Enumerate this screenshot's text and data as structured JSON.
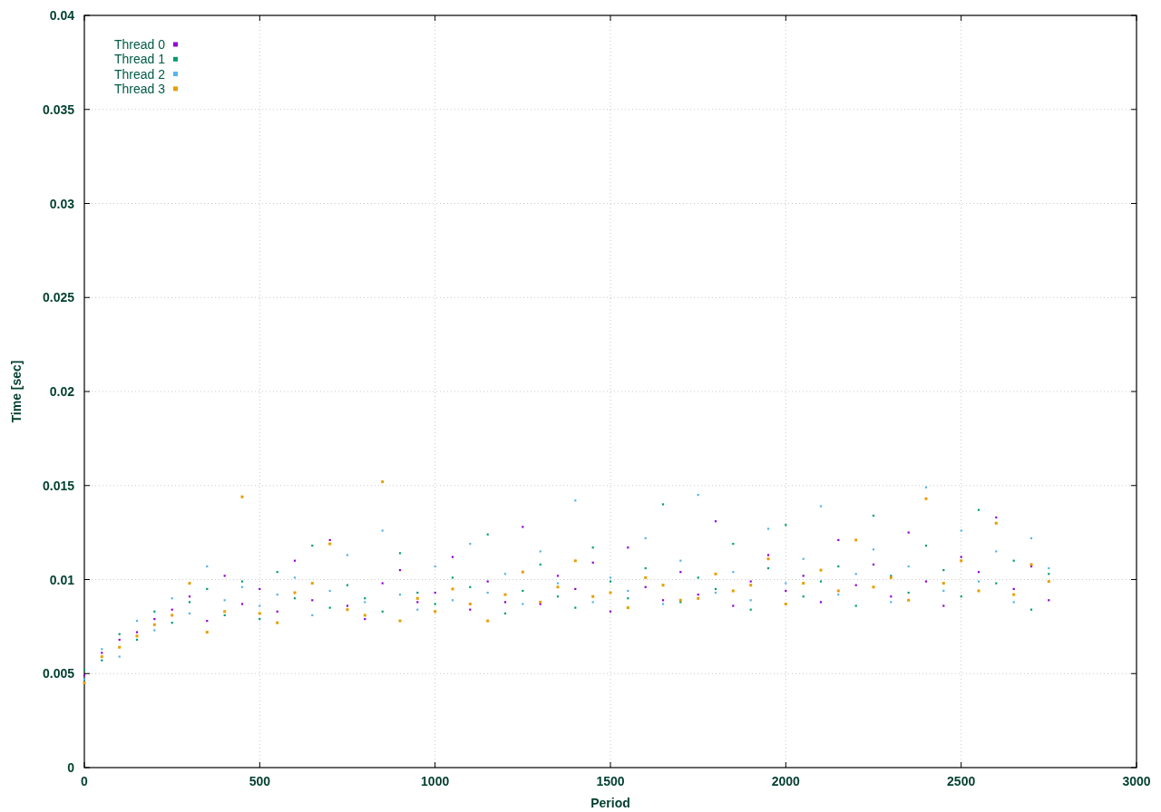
{
  "chart_data": {
    "type": "scatter",
    "grid": true,
    "legend": true,
    "xlabel": "Period",
    "ylabel": "Time [sec]",
    "xlim": [
      0,
      3000
    ],
    "ylim": [
      0,
      0.04
    ],
    "xticks": [
      0,
      500,
      1000,
      1500,
      2000,
      2500,
      3000
    ],
    "yticks": [
      {
        "value": 0,
        "label": "0"
      },
      {
        "value": 0.005,
        "label": "0.005"
      },
      {
        "value": 0.01,
        "label": "0.01"
      },
      {
        "value": 0.015,
        "label": "0.015"
      },
      {
        "value": 0.02,
        "label": "0.02"
      },
      {
        "value": 0.025,
        "label": "0.025"
      },
      {
        "value": 0.03,
        "label": "0.03"
      },
      {
        "value": 0.035,
        "label": "0.035"
      },
      {
        "value": 0.04,
        "label": "0.04"
      }
    ],
    "x": [
      0,
      50,
      100,
      150,
      200,
      250,
      300,
      350,
      400,
      450,
      500,
      550,
      600,
      650,
      700,
      750,
      800,
      850,
      900,
      950,
      1000,
      1050,
      1100,
      1150,
      1200,
      1250,
      1300,
      1350,
      1400,
      1450,
      1500,
      1550,
      1600,
      1650,
      1700,
      1750,
      1800,
      1850,
      1900,
      1950,
      2000,
      2050,
      2100,
      2150,
      2200,
      2250,
      2300,
      2350,
      2400,
      2450,
      2500,
      2550,
      2600,
      2650,
      2700,
      2750
    ],
    "series": [
      {
        "name": "Thread 0",
        "color": "#9400d3",
        "values": [
          0.0049,
          0.0061,
          0.0068,
          0.0072,
          0.0079,
          0.0084,
          0.0091,
          0.0078,
          0.0102,
          0.0087,
          0.0095,
          0.0083,
          0.011,
          0.0089,
          0.0121,
          0.0086,
          0.0079,
          0.0098,
          0.0105,
          0.0088,
          0.0093,
          0.0112,
          0.0084,
          0.0099,
          0.0088,
          0.0128,
          0.0087,
          0.0102,
          0.0095,
          0.0109,
          0.0083,
          0.0117,
          0.0096,
          0.0089,
          0.0104,
          0.0092,
          0.0131,
          0.0086,
          0.0099,
          0.0113,
          0.0094,
          0.0102,
          0.0088,
          0.0121,
          0.0097,
          0.0108,
          0.0091,
          0.0125,
          0.0099,
          0.0086,
          0.0112,
          0.0104,
          0.0133,
          0.0095,
          0.0107,
          0.0089
        ]
      },
      {
        "name": "Thread 1",
        "color": "#009e73",
        "values": [
          0.0052,
          0.0057,
          0.0071,
          0.0068,
          0.0083,
          0.0077,
          0.0088,
          0.0095,
          0.0081,
          0.0099,
          0.0079,
          0.0104,
          0.009,
          0.0118,
          0.0085,
          0.0097,
          0.009,
          0.0083,
          0.0114,
          0.0093,
          0.0087,
          0.0101,
          0.0096,
          0.0124,
          0.0082,
          0.0094,
          0.0108,
          0.0091,
          0.0085,
          0.0117,
          0.0099,
          0.009,
          0.0106,
          0.014,
          0.0088,
          0.0101,
          0.0095,
          0.0119,
          0.0084,
          0.0106,
          0.0129,
          0.0091,
          0.0099,
          0.0107,
          0.0086,
          0.0134,
          0.0102,
          0.0093,
          0.0118,
          0.0105,
          0.0091,
          0.0137,
          0.0098,
          0.011,
          0.0084,
          0.0103
        ]
      },
      {
        "name": "Thread 2",
        "color": "#56b4e9",
        "values": [
          0.0047,
          0.0063,
          0.0059,
          0.0078,
          0.0073,
          0.009,
          0.0082,
          0.0107,
          0.0089,
          0.0096,
          0.0086,
          0.0092,
          0.0101,
          0.0081,
          0.0094,
          0.0113,
          0.0088,
          0.0126,
          0.0092,
          0.0084,
          0.0107,
          0.0089,
          0.0119,
          0.0093,
          0.0103,
          0.0087,
          0.0115,
          0.0098,
          0.0142,
          0.0088,
          0.0101,
          0.0094,
          0.0122,
          0.0087,
          0.011,
          0.0145,
          0.0093,
          0.0104,
          0.0089,
          0.0127,
          0.0098,
          0.0111,
          0.0139,
          0.0092,
          0.0103,
          0.0116,
          0.0088,
          0.0107,
          0.0149,
          0.0094,
          0.0126,
          0.0099,
          0.0115,
          0.0088,
          0.0122,
          0.0106
        ]
      },
      {
        "name": "Thread 3",
        "color": "#e69f00",
        "values": [
          0.0045,
          0.0059,
          0.0064,
          0.007,
          0.0076,
          0.0081,
          0.0098,
          0.0072,
          0.0083,
          0.0144,
          0.0082,
          0.0077,
          0.0093,
          0.0098,
          0.0119,
          0.0084,
          0.0081,
          0.0152,
          0.0078,
          0.009,
          0.0083,
          0.0095,
          0.0087,
          0.0078,
          0.0092,
          0.0104,
          0.0088,
          0.0096,
          0.011,
          0.0091,
          0.0093,
          0.0085,
          0.0101,
          0.0097,
          0.0089,
          0.009,
          0.0103,
          0.0094,
          0.0097,
          0.0111,
          0.0087,
          0.0098,
          0.0105,
          0.0094,
          0.0121,
          0.0096,
          0.0101,
          0.0089,
          0.0143,
          0.0098,
          0.011,
          0.0094,
          0.013,
          0.0092,
          0.0108,
          0.0099
        ]
      }
    ]
  }
}
